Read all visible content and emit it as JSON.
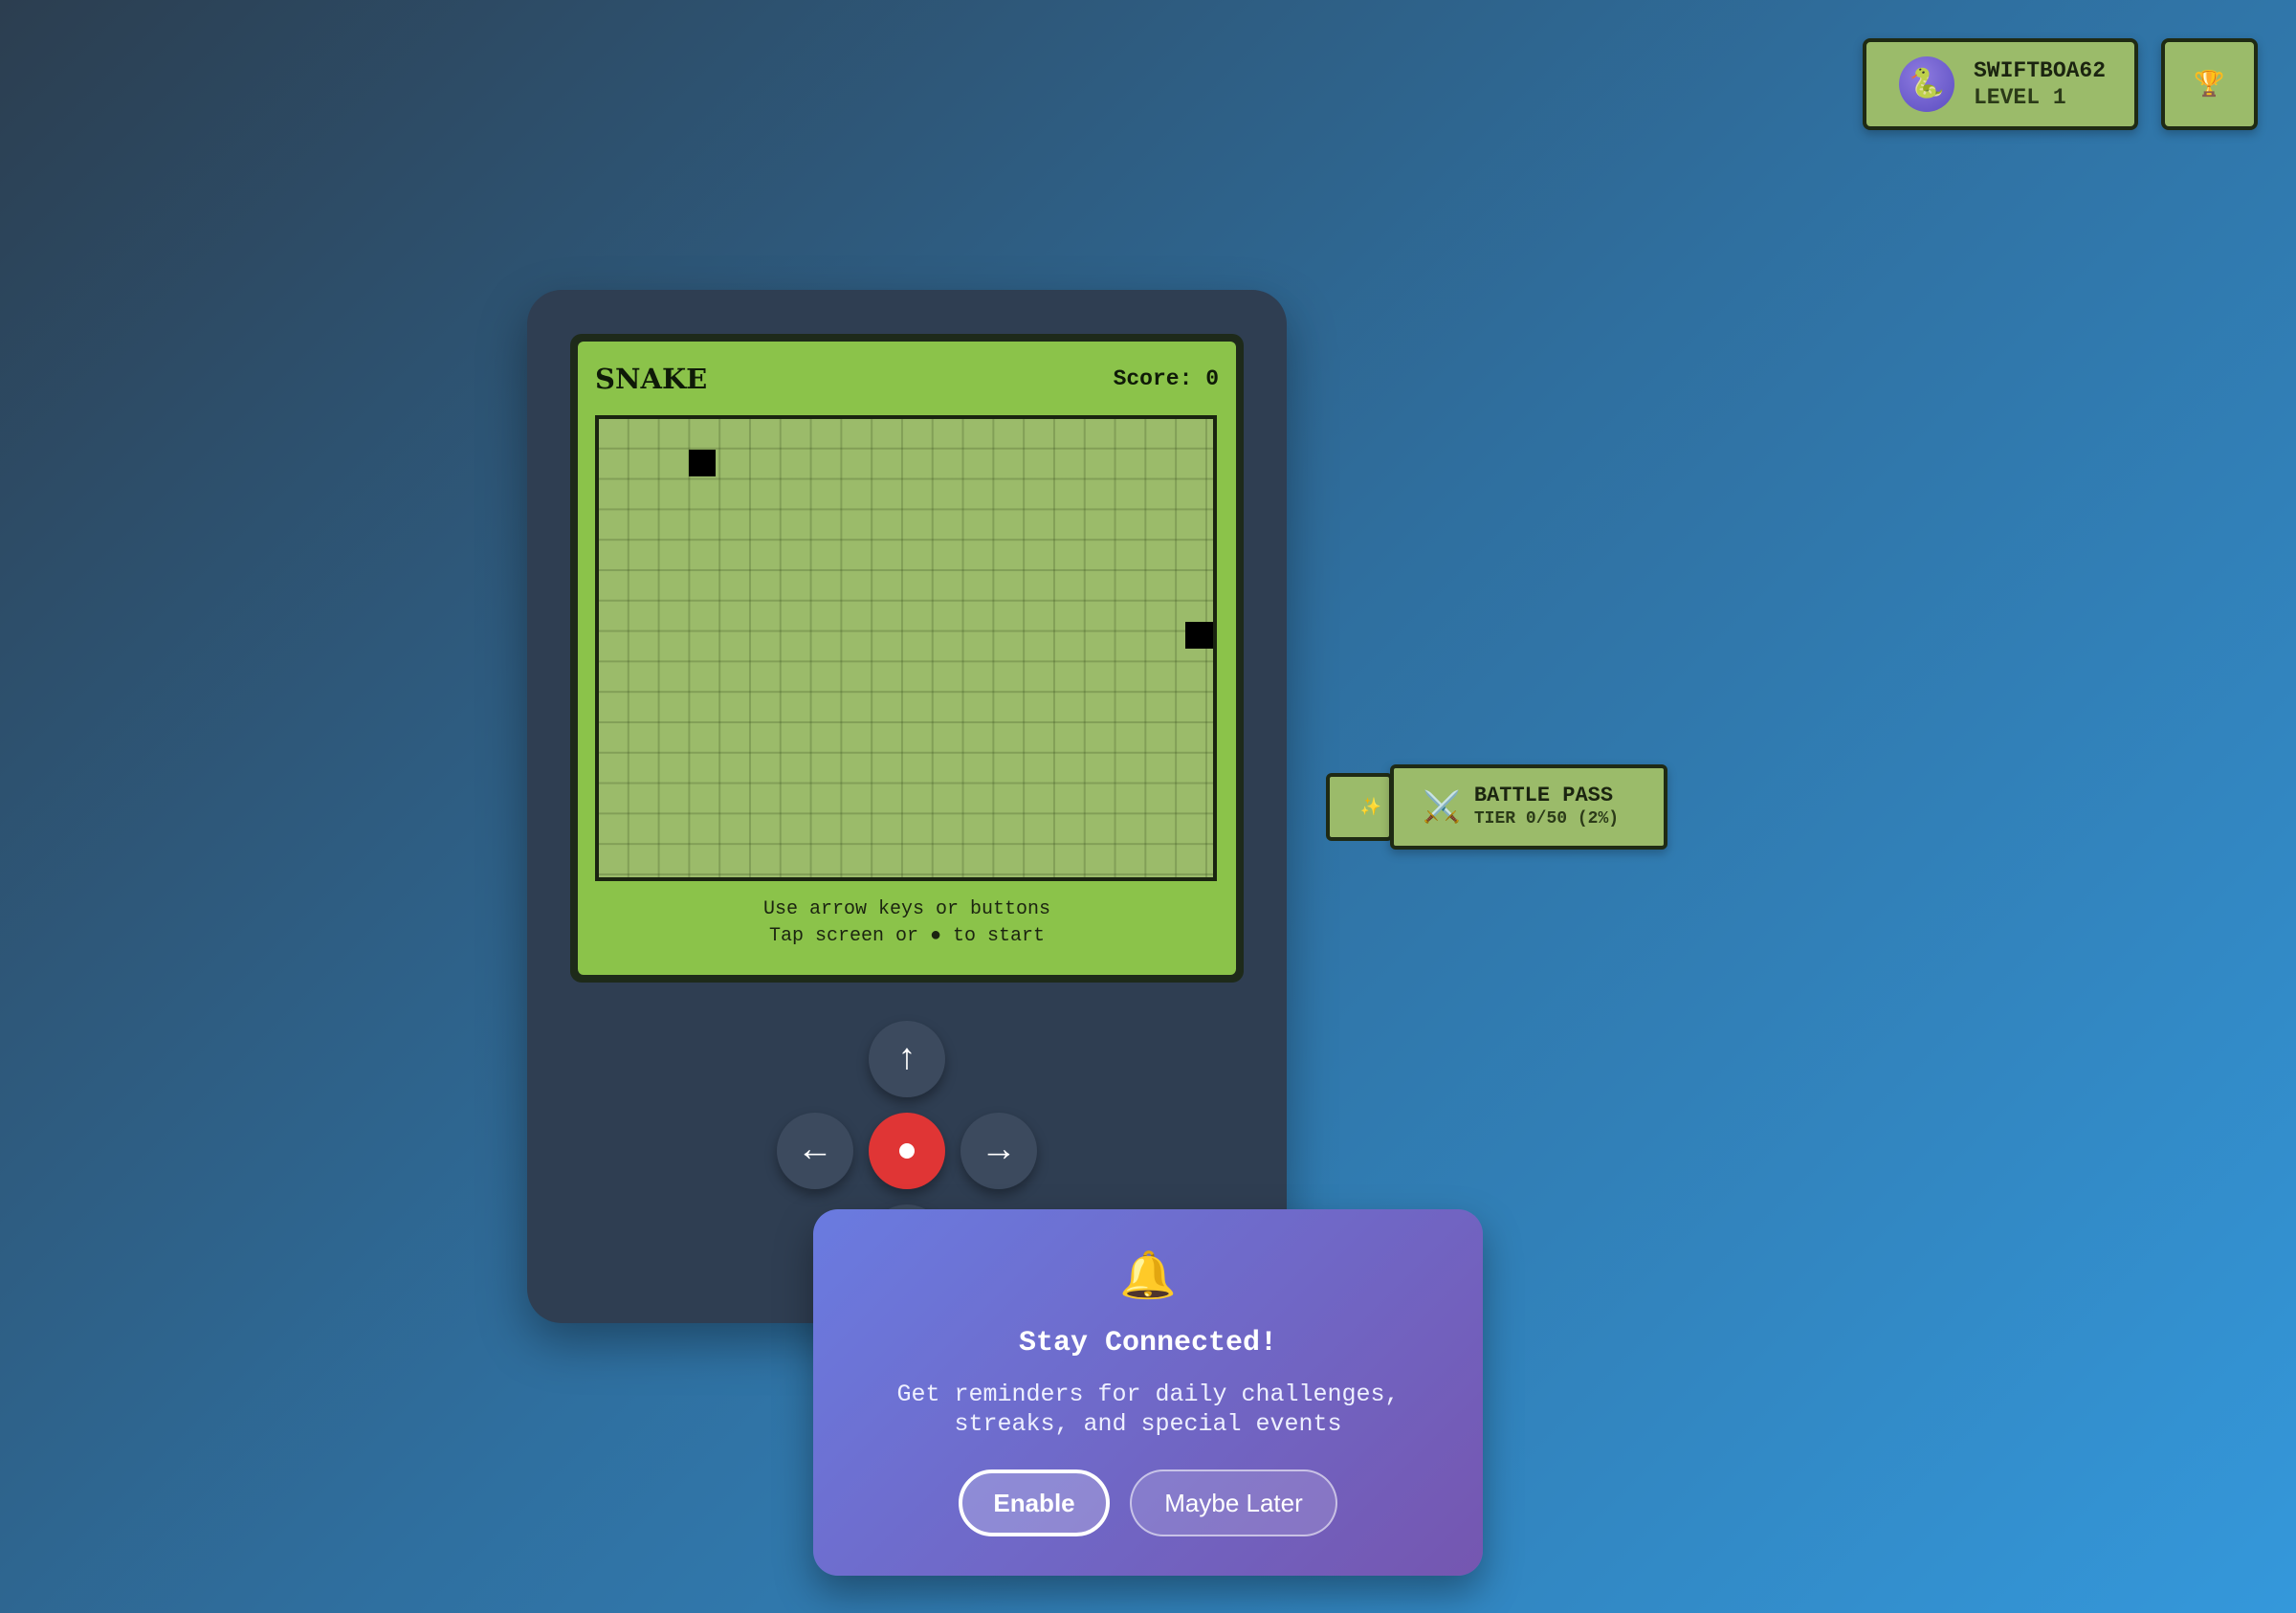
{
  "profile": {
    "avatar_icon": "🐍",
    "username": "SWIFTBOA62",
    "level": "LEVEL 1",
    "trophy_icon": "🏆"
  },
  "game": {
    "title": "SNAKE",
    "score": "Score: 0",
    "grid": {
      "cols": 21,
      "rows": 16
    },
    "snake_head": {
      "col": 3,
      "row": 1
    },
    "food": {
      "col": 20,
      "row": 7
    },
    "instructions_line1": "Use arrow keys or buttons",
    "instructions_line2": "Tap screen or ● to start"
  },
  "controls": {
    "up": "↑",
    "left": "←",
    "right": "→",
    "down": "↓"
  },
  "battle_pass": {
    "spark_icon": "✨",
    "icon": "⚔️",
    "title": "BATTLE PASS",
    "tier": "TIER 0/50 (2%)"
  },
  "notification": {
    "icon": "🔔",
    "title": "Stay Connected!",
    "description_line1": "Get reminders for daily challenges,",
    "description_line2": "streaks, and special events",
    "enable_label": "Enable",
    "later_label": "Maybe Later"
  }
}
